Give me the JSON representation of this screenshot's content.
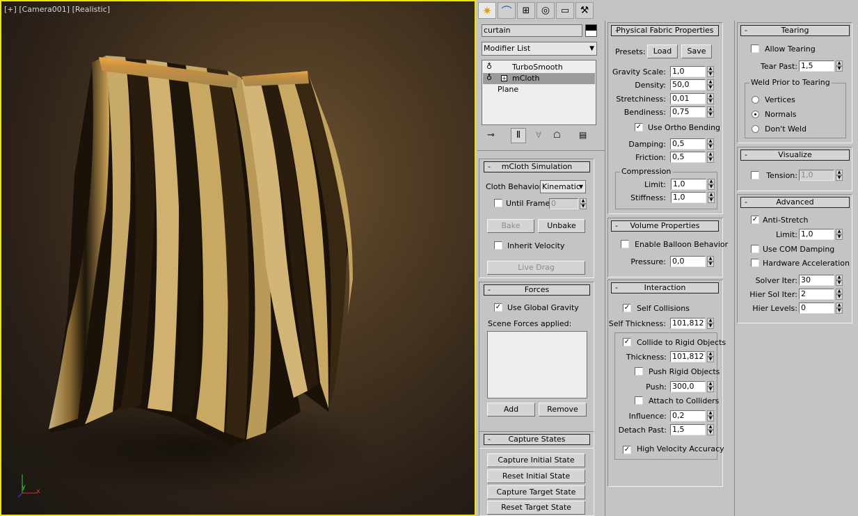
{
  "viewport": {
    "label_plus": "[+]",
    "label_camera": "[Camera001]",
    "label_mode": "[Realistic]",
    "axis_y": "y",
    "axis_x": "x"
  },
  "tabs": [
    {
      "icon": "create-sun-icon",
      "active": true
    },
    {
      "icon": "modify-curve-icon"
    },
    {
      "icon": "hierarchy-icon"
    },
    {
      "icon": "motion-icon"
    },
    {
      "icon": "display-monitor-icon"
    },
    {
      "icon": "utilities-hammer-icon"
    }
  ],
  "object": {
    "name": "curtain",
    "color": "#000000"
  },
  "modifier_list": {
    "label": "Modifier List"
  },
  "stack": [
    "TurboSmooth",
    "mCloth",
    "Plane"
  ],
  "stack_selected": 1,
  "sim": {
    "title": "mCloth Simulation",
    "behavior_label": "Cloth Behavior:",
    "behavior_value": "Kinematic",
    "until_frame": "Until Frame",
    "until_frame_val": "0",
    "bake": "Bake",
    "unbake": "Unbake",
    "inherit_velocity": "Inherit Velocity",
    "live_drag": "Live Drag"
  },
  "forces": {
    "title": "Forces",
    "use_global_gravity": "Use Global Gravity",
    "scene_forces": "Scene Forces applied:",
    "add": "Add",
    "remove": "Remove"
  },
  "capture": {
    "title": "Capture States",
    "capture_initial": "Capture Initial State",
    "reset_initial": "Reset Initial State",
    "capture_target": "Capture Target State",
    "reset_target": "Reset Target State"
  },
  "physical": {
    "title": "Physical Fabric Properties",
    "presets": "Presets:",
    "load": "Load",
    "save": "Save",
    "gravity_scale": "Gravity Scale:",
    "gravity_scale_v": "1,0",
    "density": "Density:",
    "density_v": "50,0",
    "stretchiness": "Stretchiness:",
    "stretchiness_v": "0,01",
    "bendiness": "Bendiness:",
    "bendiness_v": "0,75",
    "ortho": "Use Ortho Bending",
    "damping": "Damping:",
    "damping_v": "0,5",
    "friction": "Friction:",
    "friction_v": "0,5",
    "compression": "Compression",
    "limit": "Limit:",
    "limit_v": "1,0",
    "stiffness": "Stiffness:",
    "stiffness_v": "1,0"
  },
  "volume": {
    "title": "Volume Properties",
    "balloon": "Enable Balloon Behavior",
    "pressure": "Pressure:",
    "pressure_v": "0,0"
  },
  "interaction": {
    "title": "Interaction",
    "self_collisions": "Self Collisions",
    "self_thickness": "Self Thickness:",
    "self_thickness_v": "101,812",
    "collide_rigid": "Collide to Rigid Objects",
    "thickness": "Thickness:",
    "thickness_v": "101,812",
    "push_rigid": "Push Rigid Objects",
    "push": "Push:",
    "push_v": "300,0",
    "attach": "Attach to Colliders",
    "influence": "Influence:",
    "influence_v": "0,2",
    "detach": "Detach Past:",
    "detach_v": "1,5",
    "high_velocity": "High Velocity Accuracy"
  },
  "tearing": {
    "title": "Tearing",
    "allow": "Allow Tearing",
    "tear_past": "Tear Past:",
    "tear_past_v": "1,5",
    "weld_prior": "Weld Prior to Tearing",
    "vertices": "Vertices",
    "normals": "Normals",
    "dont_weld": "Don't Weld"
  },
  "visualize": {
    "title": "Visualize",
    "tension": "Tension:",
    "tension_v": "1,0"
  },
  "advanced": {
    "title": "Advanced",
    "anti_stretch": "Anti-Stretch",
    "limit": "Limit:",
    "limit_v": "1,0",
    "com_damping": "Use COM Damping",
    "hw_accel": "Hardware Acceleration",
    "solver_iter": "Solver Iter:",
    "solver_iter_v": "30",
    "hier_sol_iter": "Hier Sol Iter:",
    "hier_sol_iter_v": "2",
    "hier_levels": "Hier Levels:",
    "hier_levels_v": "0"
  },
  "minus": "-",
  "check": "✓"
}
